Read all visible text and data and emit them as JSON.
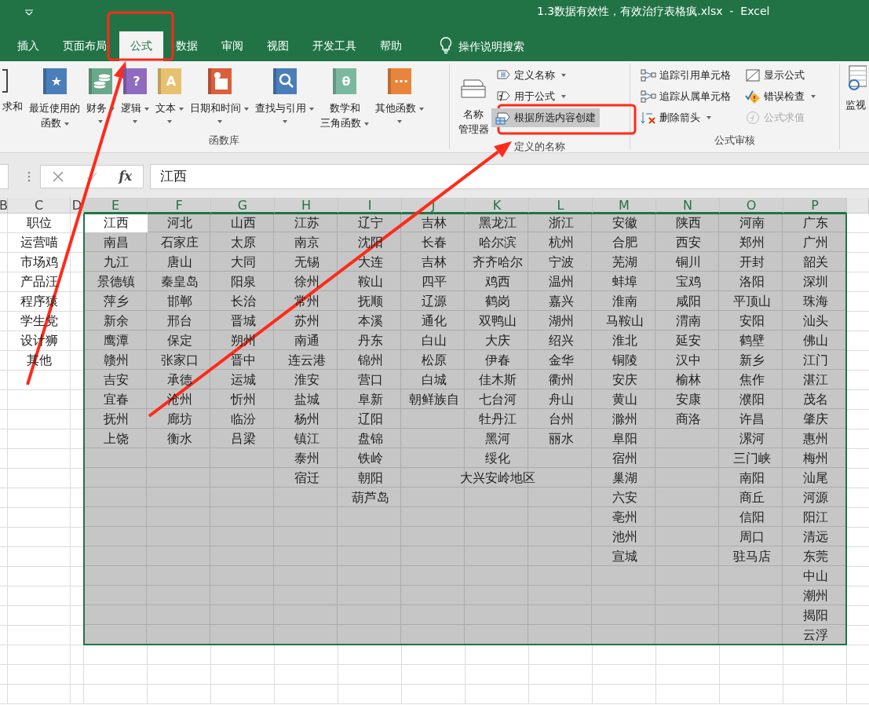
{
  "window": {
    "title": "1.3数据有效性，有效治疗表格疯.xlsx  -  Excel"
  },
  "tabs": [
    {
      "label": "插入",
      "selected": false
    },
    {
      "label": "页面布局",
      "selected": false
    },
    {
      "label": "公式",
      "selected": true
    },
    {
      "label": "数据",
      "selected": false
    },
    {
      "label": "审阅",
      "selected": false
    },
    {
      "label": "视图",
      "selected": false
    },
    {
      "label": "开发工具",
      "selected": false
    },
    {
      "label": "帮助",
      "selected": false
    }
  ],
  "tell_me": {
    "label": "操作说明搜索"
  },
  "ribbon": {
    "function_library": {
      "label": "函数库",
      "items": [
        {
          "kind": "partial",
          "lines": [
            "求和"
          ],
          "dropdown": false
        },
        {
          "kind": "glyph",
          "glyph": "★",
          "color": "#4a7ebb",
          "lines": [
            "最近使用的",
            "函数"
          ],
          "dropdown": true
        },
        {
          "kind": "coins",
          "color": "#6aa88c",
          "lines": [
            "财务"
          ],
          "dropdown": true
        },
        {
          "kind": "glyph",
          "glyph": "?",
          "color": "#8e6bbf",
          "lines": [
            "逻辑"
          ],
          "dropdown": true
        },
        {
          "kind": "glyph",
          "glyph": "A",
          "color": "#e8c170",
          "lines": [
            "文本"
          ],
          "dropdown": true
        },
        {
          "kind": "calendar",
          "color": "#d9603b",
          "lines": [
            "日期和时间"
          ],
          "dropdown": true
        },
        {
          "kind": "magnifier",
          "color": "#4a7ebb",
          "lines": [
            "查找与引用"
          ],
          "dropdown": true
        },
        {
          "kind": "glyph",
          "glyph": "θ",
          "color": "#7ab8a0",
          "lines": [
            "数学和",
            "三角函数"
          ],
          "dropdown": true
        },
        {
          "kind": "glyph",
          "glyph": "···",
          "color": "#e8843c",
          "lines": [
            "其他函数"
          ],
          "dropdown": true
        }
      ]
    },
    "defined_names": {
      "label": "定义的名称",
      "manager": {
        "lines": [
          "名称",
          "管理器"
        ]
      },
      "items": [
        {
          "kind": "tag",
          "label": "定义名称",
          "dropdown": true,
          "highlighted": false
        },
        {
          "kind": "fx",
          "label": "用于公式",
          "dropdown": true,
          "highlighted": false
        },
        {
          "kind": "table",
          "label": "根据所选内容创建",
          "dropdown": false,
          "highlighted": true
        }
      ]
    },
    "formula_auditing": {
      "label": "公式审核",
      "columns": [
        [
          {
            "kind": "trace",
            "label": "追踪引用单元格",
            "dropdown": false,
            "disabled": false
          },
          {
            "kind": "trace",
            "label": "追踪从属单元格",
            "dropdown": false,
            "disabled": false
          },
          {
            "kind": "remove",
            "label": "删除箭头",
            "dropdown": true,
            "disabled": false
          }
        ],
        [
          {
            "kind": "show",
            "label": "显示公式",
            "dropdown": false,
            "disabled": false
          },
          {
            "kind": "error",
            "label": "错误检查",
            "dropdown": true,
            "disabled": false
          },
          {
            "kind": "evaluate",
            "label": "公式求值",
            "dropdown": false,
            "disabled": true
          }
        ]
      ]
    },
    "watch": {
      "label": "监视"
    }
  },
  "formula_bar": {
    "fx": "fx",
    "value": "江西"
  },
  "sheet": {
    "columns": [
      {
        "header": "B",
        "selected": false,
        "active": false
      },
      {
        "header": "C",
        "selected": false,
        "active": false,
        "cells": [
          "职位",
          "运营喵",
          "市场鸡",
          "产品汪",
          "程序猿",
          "学生党",
          "设计狮",
          "其他"
        ]
      },
      {
        "header": "D",
        "selected": false,
        "active": false
      },
      {
        "header": "E",
        "selected": true,
        "active": true,
        "cells": [
          "江西",
          "南昌",
          "九江",
          "景德镇",
          "萍乡",
          "新余",
          "鹰潭",
          "赣州",
          "吉安",
          "宜春",
          "抚州",
          "上饶"
        ]
      },
      {
        "header": "F",
        "selected": true,
        "active": false,
        "cells": [
          "河北",
          "石家庄",
          "唐山",
          "秦皇岛",
          "邯郸",
          "邢台",
          "保定",
          "张家口",
          "承德",
          "沧州",
          "廊坊",
          "衡水"
        ]
      },
      {
        "header": "G",
        "selected": true,
        "active": false,
        "cells": [
          "山西",
          "太原",
          "大同",
          "阳泉",
          "长治",
          "晋城",
          "朔州",
          "晋中",
          "运城",
          "忻州",
          "临汾",
          "吕梁"
        ]
      },
      {
        "header": "H",
        "selected": true,
        "active": false,
        "cells": [
          "江苏",
          "南京",
          "无锡",
          "徐州",
          "常州",
          "苏州",
          "南通",
          "连云港",
          "淮安",
          "盐城",
          "杨州",
          "镇江",
          "泰州",
          "宿迁"
        ]
      },
      {
        "header": "I",
        "selected": true,
        "active": false,
        "cells": [
          "辽宁",
          "沈阳",
          "大连",
          "鞍山",
          "抚顺",
          "本溪",
          "丹东",
          "锦州",
          "营口",
          "阜新",
          "辽阳",
          "盘锦",
          "铁岭",
          "朝阳",
          "葫芦岛"
        ]
      },
      {
        "header": "J",
        "selected": true,
        "active": false,
        "cells": [
          "吉林",
          "长春",
          "吉林",
          "四平",
          "辽源",
          "通化",
          "白山",
          "松原",
          "白城",
          "朝鲜族自"
        ]
      },
      {
        "header": "K",
        "selected": true,
        "active": false,
        "cells": [
          "黑龙江",
          "哈尔滨",
          "齐齐哈尔",
          "鸡西",
          "鹤岗",
          "双鸭山",
          "大庆",
          "伊春",
          "佳木斯",
          "七台河",
          "牡丹江",
          "黑河",
          "绥化",
          "大兴安岭地区"
        ]
      },
      {
        "header": "L",
        "selected": true,
        "active": false,
        "cells": [
          "浙江",
          "杭州",
          "宁波",
          "温州",
          "嘉兴",
          "湖州",
          "绍兴",
          "金华",
          "衢州",
          "舟山",
          "台州",
          "丽水"
        ]
      },
      {
        "header": "M",
        "selected": true,
        "active": false,
        "cells": [
          "安徽",
          "合肥",
          "芜湖",
          "蚌埠",
          "淮南",
          "马鞍山",
          "淮北",
          "铜陵",
          "安庆",
          "黄山",
          "滁州",
          "阜阳",
          "宿州",
          "巢湖",
          "六安",
          "亳州",
          "池州",
          "宣城"
        ]
      },
      {
        "header": "N",
        "selected": true,
        "active": false,
        "cells": [
          "陕西",
          "西安",
          "铜川",
          "宝鸡",
          "咸阳",
          "渭南",
          "延安",
          "汉中",
          "榆林",
          "安康",
          "商洛"
        ]
      },
      {
        "header": "O",
        "selected": true,
        "active": false,
        "cells": [
          "河南",
          "郑州",
          "开封",
          "洛阳",
          "平顶山",
          "安阳",
          "鹤壁",
          "新乡",
          "焦作",
          "濮阳",
          "许昌",
          "漯河",
          "三门峡",
          "南阳",
          "商丘",
          "信阳",
          "周口",
          "驻马店"
        ]
      },
      {
        "header": "P",
        "selected": true,
        "active": false,
        "cells": [
          "广东",
          "广州",
          "韶关",
          "深圳",
          "珠海",
          "汕头",
          "佛山",
          "江门",
          "湛江",
          "茂名",
          "肇庆",
          "惠州",
          "梅州",
          "汕尾",
          "河源",
          "阳江",
          "清远",
          "东莞",
          "中山",
          "潮州",
          "揭阳",
          "云浮"
        ]
      }
    ]
  }
}
